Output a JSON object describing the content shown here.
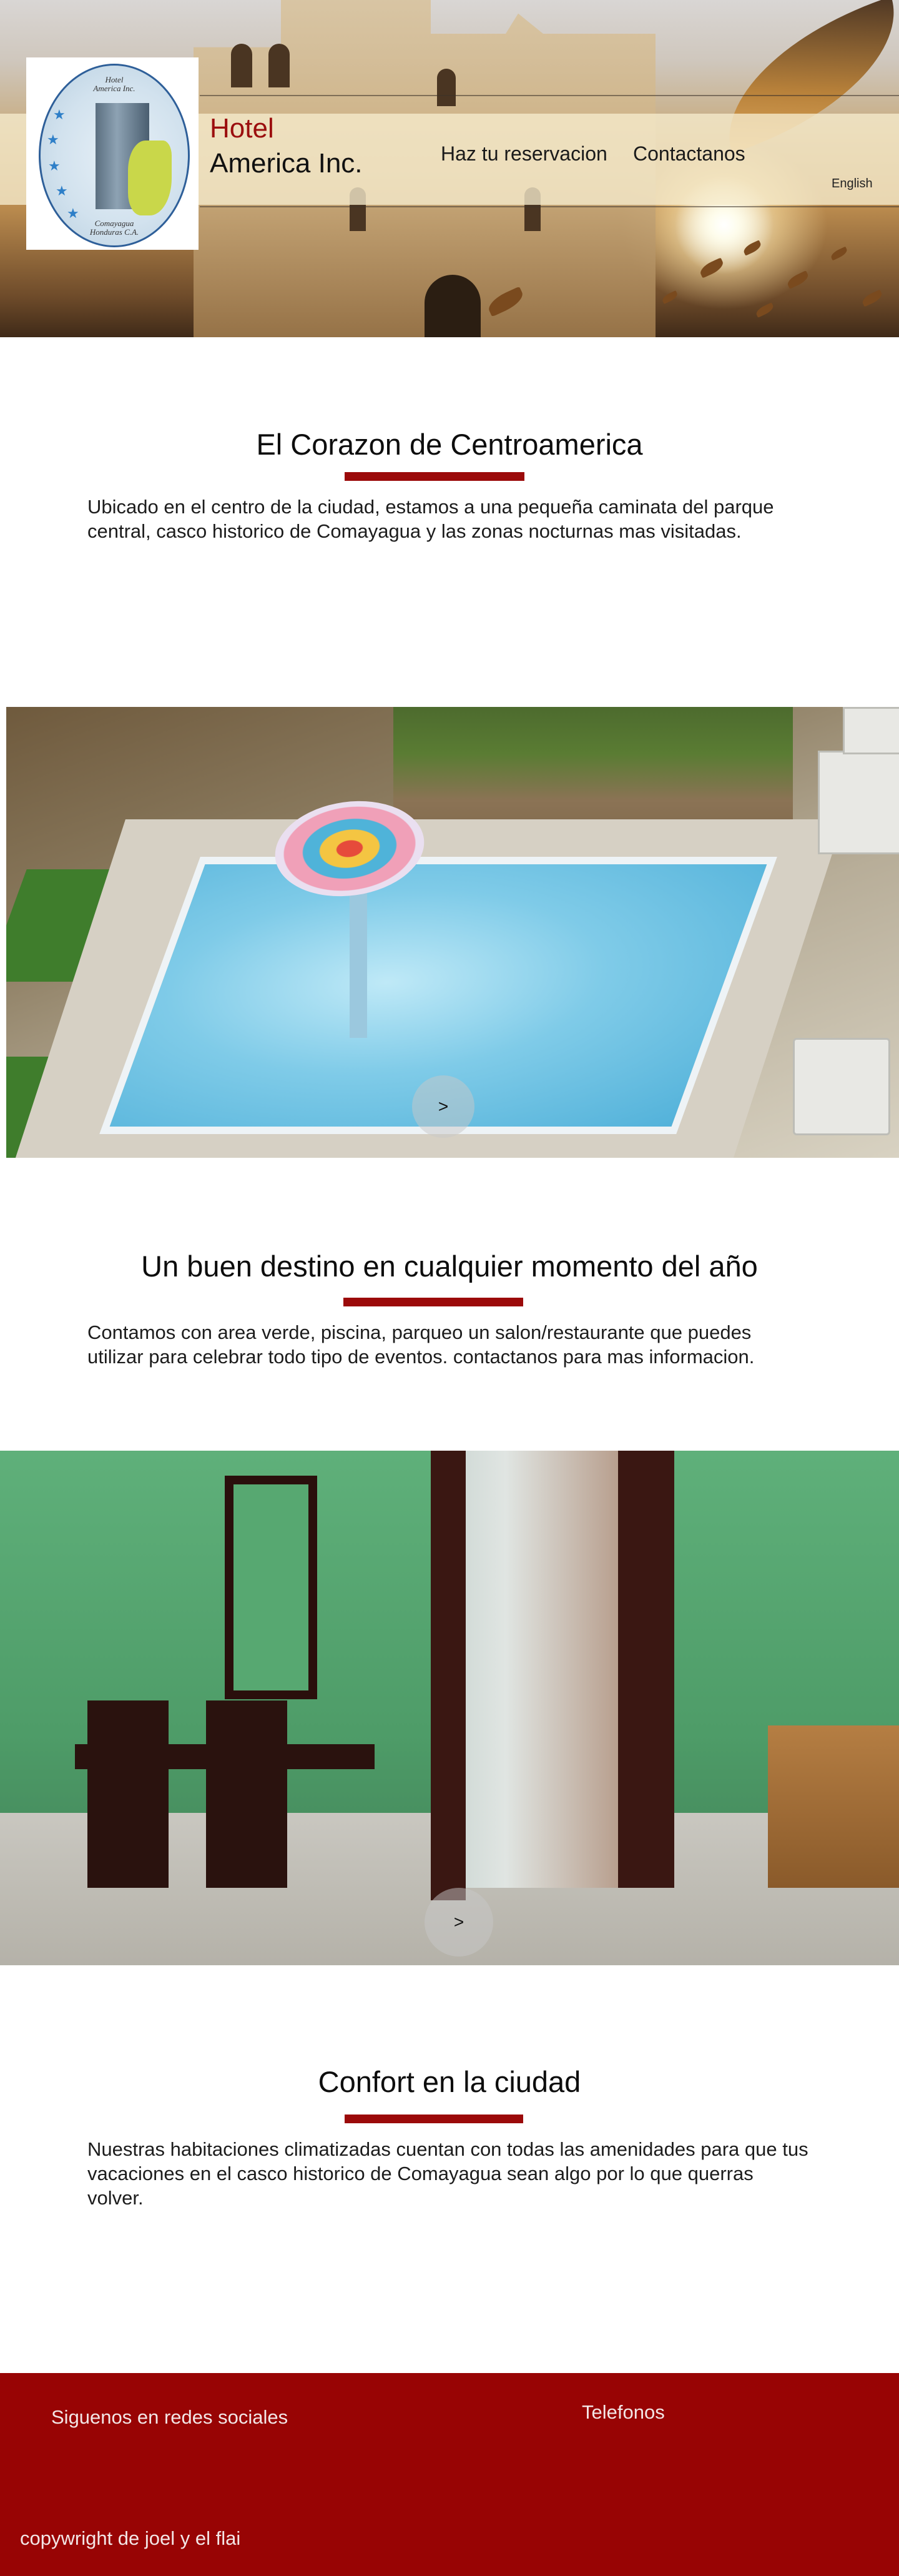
{
  "header": {
    "brand_line1": "Hotel",
    "brand_line2": "America Inc.",
    "nav": [
      {
        "label": "Haz tu reservacion"
      },
      {
        "label": "Contactanos"
      }
    ],
    "language": "English",
    "logo": {
      "top_text_1": "Hotel",
      "top_text_2": "America Inc.",
      "bottom_text_1": "Comayagua",
      "bottom_text_2": "Honduras C.A."
    }
  },
  "sections": [
    {
      "title": "El Corazon de Centroamerica",
      "text": "Ubicado en el centro de la ciudad, estamos a una pequeña caminata del parque central, casco historico de Comayagua y las zonas nocturnas mas visitadas."
    },
    {
      "title": "Un buen destino en cualquier momento del año",
      "text": "Contamos con area verde, piscina, parqueo un salon/restaurante que puedes utilizar para celebrar todo tipo de eventos. contactanos para mas informacion."
    },
    {
      "title": "Confort en la ciudad",
      "text": "Nuestras habitaciones climatizadas cuentan con todas las amenidades para que tus vacaciones en el casco historico de Comayagua sean algo por lo que querras volver."
    }
  ],
  "sliders": {
    "pool_next": ">",
    "room_next": ">"
  },
  "footer": {
    "social_label": "Siguenos en redes sociales",
    "phones_label": "Telefonos",
    "copyright": "copywright de joel y el flai"
  },
  "colors": {
    "brand_red": "#9b0e0e",
    "footer_bg": "#980404",
    "header_band": "#f6eccd"
  }
}
